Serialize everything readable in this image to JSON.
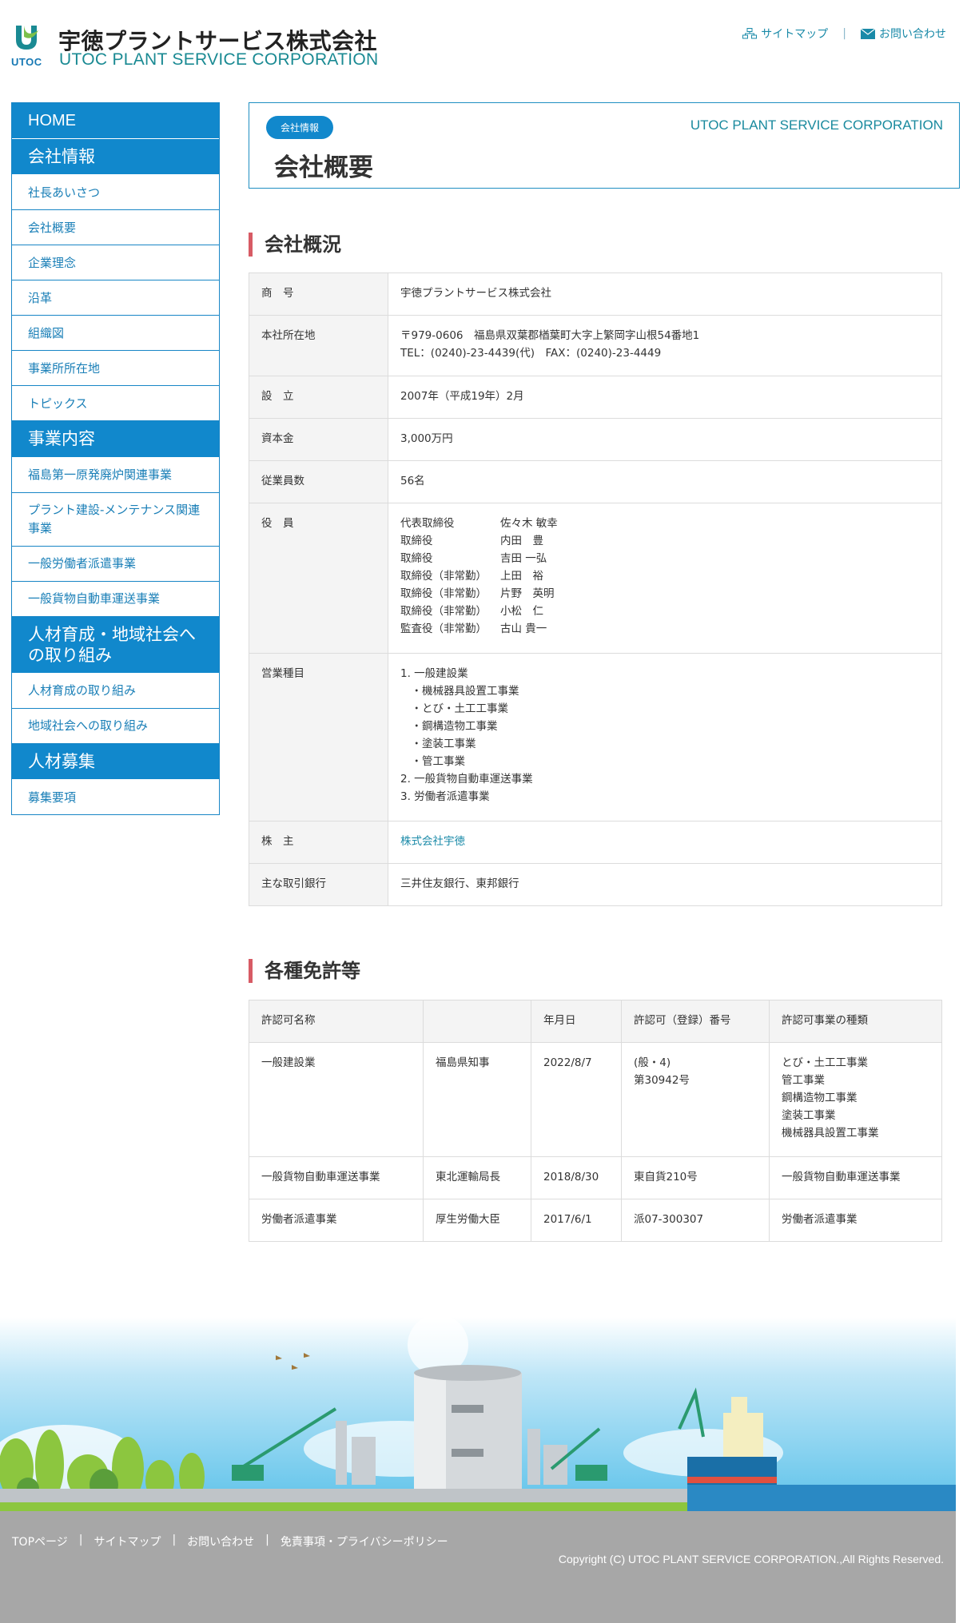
{
  "header": {
    "logo_text": "UTOC",
    "company_jp": "宇徳プラントサービス株式会社",
    "company_en": "UTOC PLANT SERVICE CORPORATION",
    "links": [
      {
        "label": "サイトマップ",
        "icon": "sitemap-icon"
      },
      {
        "label": "お問い合わせ",
        "icon": "mail-icon"
      }
    ],
    "separator": "|"
  },
  "sidebar": {
    "home": "HOME",
    "sections": [
      {
        "title": "会社情報",
        "items": [
          "社長あいさつ",
          "会社概要",
          "企業理念",
          "沿革",
          "組織図",
          "事業所所在地",
          "トピックス"
        ]
      },
      {
        "title": "事業内容",
        "items": [
          "福島第一原発廃炉関連事業",
          "プラント建設-メンテナンス関連事業",
          "一般労働者派遣事業",
          "一般貨物自動車運送事業"
        ]
      },
      {
        "title": "人材育成・地域社会への取り組み",
        "items": [
          "人材育成の取り組み",
          "地域社会への取り組み"
        ]
      },
      {
        "title": "人材募集",
        "items": [
          "募集要項"
        ]
      }
    ]
  },
  "page": {
    "badge": "会社情報",
    "title": "会社概要",
    "corp_en": "UTOC PLANT SERVICE CORPORATION"
  },
  "overview": {
    "title": "会社概況",
    "rows": [
      {
        "key": "商　号",
        "lines": [
          "宇徳プラントサービス株式会社"
        ]
      },
      {
        "key": "本社所在地",
        "lines": [
          "〒979-0606　福島県双葉郡楢葉町大字上繁岡字山根54番地1",
          "TEL：(0240)-23-4439(代)　FAX：(0240)-23-4449"
        ]
      },
      {
        "key": "設　立",
        "lines": [
          "2007年（平成19年）2月"
        ]
      },
      {
        "key": "資本金",
        "lines": [
          "3,000万円"
        ]
      },
      {
        "key": "従業員数",
        "lines": [
          "56名"
        ]
      },
      {
        "key": "役　員",
        "officers": [
          {
            "role": "代表取締役",
            "name": "佐々木 敏幸"
          },
          {
            "role": "取締役",
            "name": "内田　豊"
          },
          {
            "role": "取締役",
            "name": "吉田 一弘"
          },
          {
            "role": "取締役（非常勤）",
            "name": "上田　裕"
          },
          {
            "role": "取締役（非常勤）",
            "name": "片野　英明"
          },
          {
            "role": "取締役（非常勤）",
            "name": "小松　仁"
          },
          {
            "role": "監査役（非常勤）",
            "name": "古山 貴一"
          }
        ]
      },
      {
        "key": "営業種目",
        "lines": [
          "1. 一般建設業",
          "　・機械器具設置工事業",
          "　・とび・土工工事業",
          "　・鋼構造物工事業",
          "　・塗装工事業",
          "　・管工事業",
          "2. 一般貨物自動車運送事業",
          "3. 労働者派遣事業"
        ]
      },
      {
        "key": "株　主",
        "link": "株式会社宇徳"
      },
      {
        "key": "主な取引銀行",
        "lines": [
          "三井住友銀行、東邦銀行"
        ]
      }
    ]
  },
  "licenses": {
    "title": "各種免許等",
    "headers": [
      "許認可名称",
      "",
      "年月日",
      "許認可（登録）番号",
      "許認可事業の種類"
    ],
    "rows": [
      {
        "name": "一般建設業",
        "authority": "福島県知事",
        "date": "2022/8/7",
        "number": [
          "(般・4)",
          "第30942号"
        ],
        "types": [
          "とび・土工工事業",
          "管工事業",
          "鋼構造物工事業",
          "塗装工事業",
          "機械器具設置工事業"
        ]
      },
      {
        "name": "一般貨物自動車運送事業",
        "authority": "東北運輸局長",
        "date": "2018/8/30",
        "number": [
          "東自貨210号"
        ],
        "types": [
          "一般貨物自動車運送事業"
        ]
      },
      {
        "name": "労働者派遣事業",
        "authority": "厚生労働大臣",
        "date": "2017/6/1",
        "number": [
          "派07-300307"
        ],
        "types": [
          "労働者派遣事業"
        ]
      }
    ]
  },
  "footer": {
    "links": [
      "TOPページ",
      "サイトマップ",
      "お問い合わせ",
      "免責事項・プライバシーポリシー"
    ],
    "separator": "|",
    "copyright": "Copyright (C) UTOC PLANT SERVICE CORPORATION.,All Rights Reserved."
  },
  "colors": {
    "primary": "#1188cc",
    "accent_teal": "#1a8a93",
    "section_bar": "#d75b65",
    "footer_bg": "#a7a7a7"
  }
}
